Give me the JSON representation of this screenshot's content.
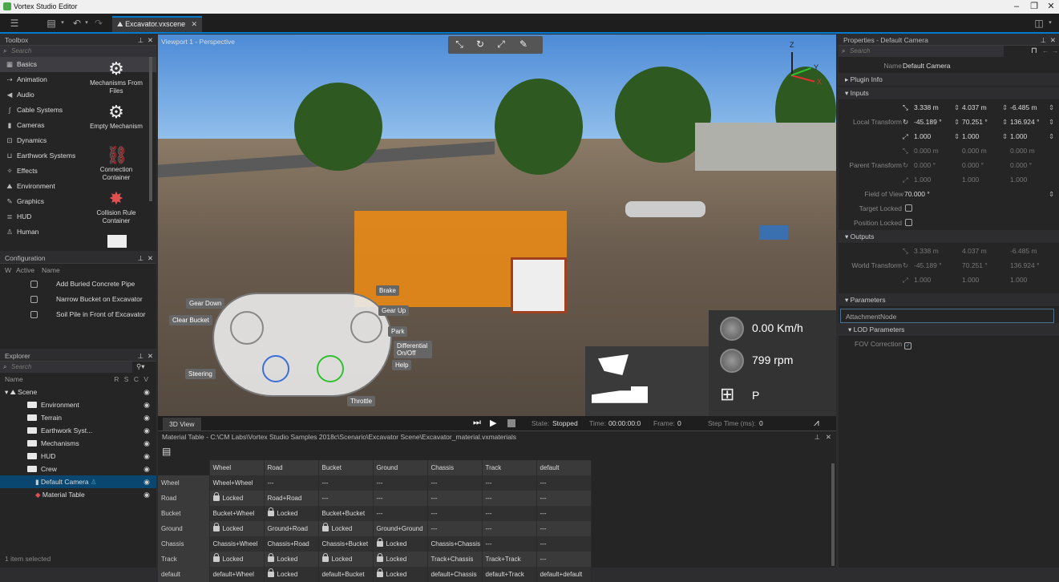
{
  "app": {
    "title": "Vortex Studio Editor"
  },
  "tab": {
    "label": "Excavator.vxscene"
  },
  "toolbox": {
    "header": "Toolbox",
    "search_placeholder": "Search",
    "categories": [
      "Basics",
      "Animation",
      "Audio",
      "Cable Systems",
      "Cameras",
      "Dynamics",
      "Earthwork Systems",
      "Effects",
      "Environment",
      "Graphics",
      "HUD",
      "Human"
    ],
    "items": [
      "Mechanisms From Files",
      "Empty Mechanism",
      "Connection Container",
      "Collision Rule Container"
    ]
  },
  "configuration": {
    "header": "Configuration",
    "columns": [
      "W",
      "Active",
      "Name"
    ],
    "rows": [
      "Add Buried Concrete Pipe",
      "Narrow Bucket on Excavator",
      "Soil Pile in Front of Excavator"
    ]
  },
  "explorer": {
    "header": "Explorer",
    "search_placeholder": "Search",
    "col_name": "Name",
    "col_flags": "R S C V",
    "items": [
      "Scene",
      "Environment",
      "Terrain",
      "Earthwork Syst...",
      "Mechanisms",
      "HUD",
      "Crew",
      "Default Camera",
      "Material Table"
    ],
    "status": "1 item selected"
  },
  "viewport": {
    "label": "Viewport 1 - Perspective",
    "gamepad_labels": [
      "Gear Down",
      "Clear Bucket",
      "Brake",
      "Gear Up",
      "Park",
      "Differential On/Off",
      "Help",
      "Steering",
      "Throttle"
    ],
    "speed": "0.00 Km/h",
    "rpm": "799 rpm",
    "gear": "P",
    "axis_x": "X",
    "axis_y": "Y",
    "axis_z": "Z"
  },
  "simbar": {
    "tab": "3D View",
    "state_label": "State:",
    "state": "Stopped",
    "time_label": "Time:",
    "time": "00:00:00:0",
    "frame_label": "Frame:",
    "frame": "0",
    "step_label": "Step Time (ms):",
    "step": "0"
  },
  "material_table": {
    "title": "Material Table - C:\\CM Labs\\Vortex Studio Samples 2018c\\Scenario\\Excavator Scene\\Excavator_material.vxmaterials",
    "columns": [
      "Wheel",
      "Road",
      "Bucket",
      "Ground",
      "Chassis",
      "Track",
      "default"
    ],
    "rows": [
      {
        "name": "Wheel",
        "cells": [
          "Wheel+Wheel",
          "---",
          "---",
          "---",
          "---",
          "---",
          "---"
        ]
      },
      {
        "name": "Road",
        "cells": [
          "Locked",
          "Road+Road",
          "---",
          "---",
          "---",
          "---",
          "---"
        ]
      },
      {
        "name": "Bucket",
        "cells": [
          "Bucket+Wheel",
          "Locked",
          "Bucket+Bucket",
          "---",
          "---",
          "---",
          "---"
        ]
      },
      {
        "name": "Ground",
        "cells": [
          "Locked",
          "Ground+Road",
          "Locked",
          "Ground+Ground",
          "---",
          "---",
          "---"
        ]
      },
      {
        "name": "Chassis",
        "cells": [
          "Chassis+Wheel",
          "Chassis+Road",
          "Chassis+Bucket",
          "Locked",
          "Chassis+Chassis",
          "---",
          "---"
        ]
      },
      {
        "name": "Track",
        "cells": [
          "Locked",
          "Locked",
          "Locked",
          "Locked",
          "Track+Chassis",
          "Track+Track",
          "---"
        ]
      },
      {
        "name": "default",
        "cells": [
          "default+Wheel",
          "Locked",
          "default+Bucket",
          "Locked",
          "default+Chassis",
          "default+Track",
          "default+default"
        ]
      }
    ]
  },
  "properties": {
    "header": "Properties - Default Camera",
    "search_placeholder": "Search",
    "name_label": "Name",
    "name_value": "Default Camera",
    "sections": {
      "plugin": "Plugin Info",
      "inputs": "Inputs",
      "outputs": "Outputs",
      "parameters": "Parameters",
      "lod": "LOD Parameters"
    },
    "local_transform_label": "Local Transform",
    "local": [
      [
        "3.338 m",
        "4.037 m",
        "-6.485 m"
      ],
      [
        "-45.189 °",
        "70.251 °",
        "136.924 °"
      ],
      [
        "1.000",
        "1.000",
        "1.000"
      ]
    ],
    "parent_transform_label": "Parent Transform",
    "parent": [
      [
        "0.000 m",
        "0.000 m",
        "0.000 m"
      ],
      [
        "0.000 °",
        "0.000 °",
        "0.000 °"
      ],
      [
        "1.000",
        "1.000",
        "1.000"
      ]
    ],
    "fov_label": "Field of View",
    "fov_value": "70.000 °",
    "target_locked": "Target Locked",
    "position_locked": "Position Locked",
    "world_transform_label": "World Transform",
    "world": [
      [
        "3.338 m",
        "4.037 m",
        "-6.485 m"
      ],
      [
        "-45.189 °",
        "70.251 °",
        "136.924 °"
      ],
      [
        "1.000",
        "1.000",
        "1.000"
      ]
    ],
    "attachment_node": "AttachmentNode",
    "fov_correction": "FOV Correction"
  },
  "colors": {
    "accent": "#007acc",
    "bg": "#252526",
    "selected": "#094771"
  }
}
